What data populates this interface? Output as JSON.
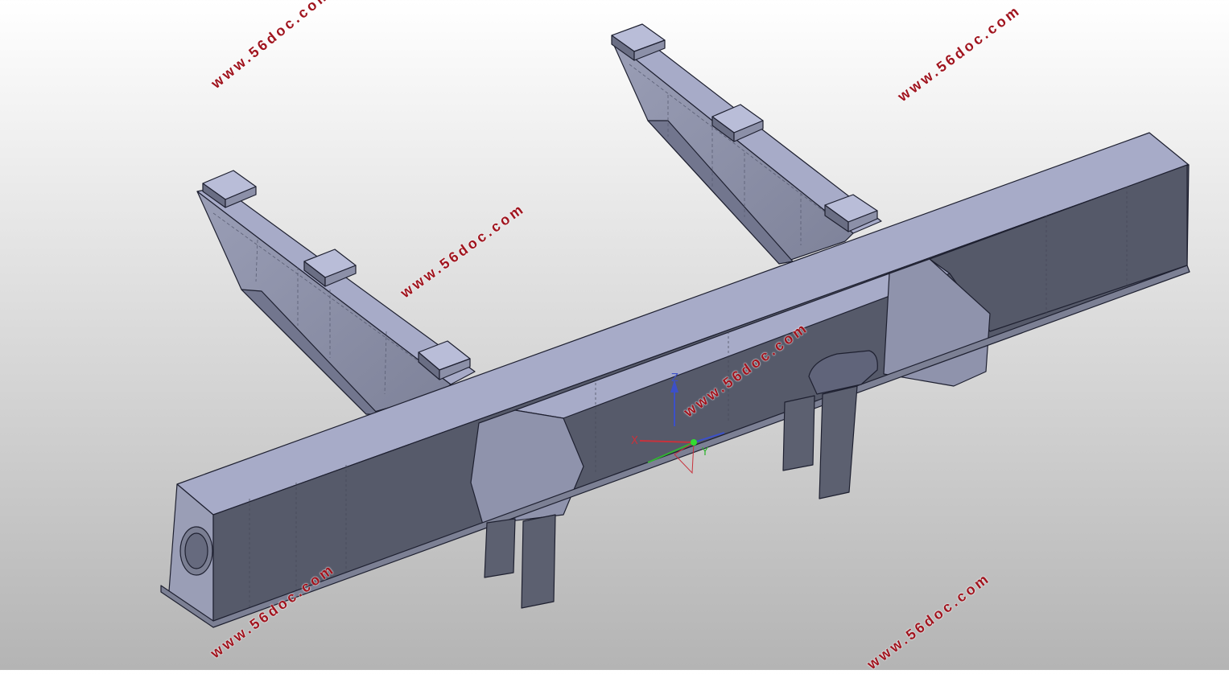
{
  "watermark": {
    "text_1": "www.56doc.com",
    "text_2": "www.56doc.com",
    "text_3": "www.56doc.com",
    "text_4": "www.56doc.com",
    "text_5": "www.56doc.com",
    "text_6": "www.56doc.com",
    "color": "#a0141e"
  },
  "triad": {
    "x_label": "X",
    "y_label": "Y",
    "z_label": "Z",
    "x_color": "#c8323c",
    "y_color": "#32b432",
    "z_color": "#3c50c8"
  },
  "colors": {
    "background_top": "#ffffff",
    "background_bottom": "#b4b4b4",
    "part_top": "#a7abc8",
    "part_side_light": "#8f93ac",
    "part_side_dark": "#565a6a",
    "edge": "#1e2030"
  }
}
